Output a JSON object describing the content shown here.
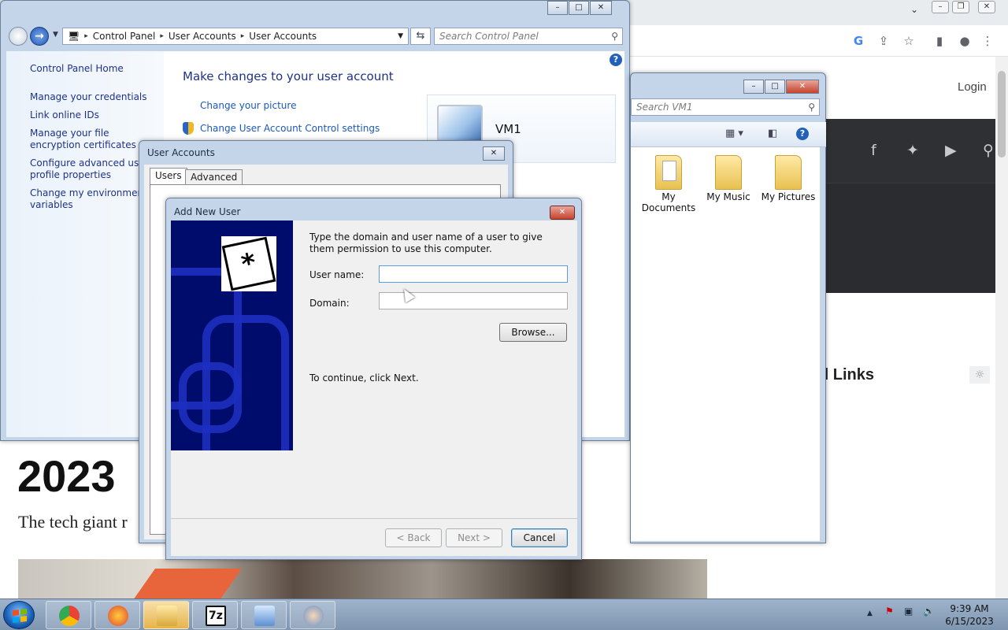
{
  "browser": {
    "login": "Login",
    "links_heading": "d Links",
    "article_year": "2023",
    "article_subtitle": "The tech giant r"
  },
  "control_panel": {
    "breadcrumb": [
      "Control Panel",
      "User Accounts",
      "User Accounts"
    ],
    "search_placeholder": "Search Control Panel",
    "sidebar": [
      "Control Panel Home",
      "Manage your credentials",
      "Link online IDs",
      "Manage your file encryption certificates",
      "Configure advanced user profile properties",
      "Change my environment variables"
    ],
    "main_title": "Make changes to your user account",
    "links": [
      "Change your picture",
      "Change User Account Control settings"
    ],
    "account_name": "VM1",
    "help": "?"
  },
  "explorer": {
    "search_placeholder": "Search VM1",
    "folders": [
      "My Documents",
      "My Music",
      "My Pictures"
    ],
    "help": "?"
  },
  "user_accounts_dialog": {
    "title": "User Accounts",
    "tabs": [
      "Users",
      "Advanced"
    ],
    "active_tab": "Users"
  },
  "add_new_user_dialog": {
    "title": "Add New User",
    "instruction": "Type the domain and user name of a user to give them permission to use this computer.",
    "username_label": "User name:",
    "username_value": "",
    "domain_label": "Domain:",
    "domain_value": "",
    "browse_button": "Browse...",
    "continue_text": "To continue, click Next.",
    "back_button": "< Back",
    "next_button": "Next >",
    "cancel_button": "Cancel"
  },
  "taskbar": {
    "apps": [
      "Google Chrome",
      "Firefox",
      "Windows Explorer",
      "7-Zip",
      "Control Panel",
      "User Accounts"
    ],
    "time": "9:39 AM",
    "date": "6/15/2023"
  }
}
